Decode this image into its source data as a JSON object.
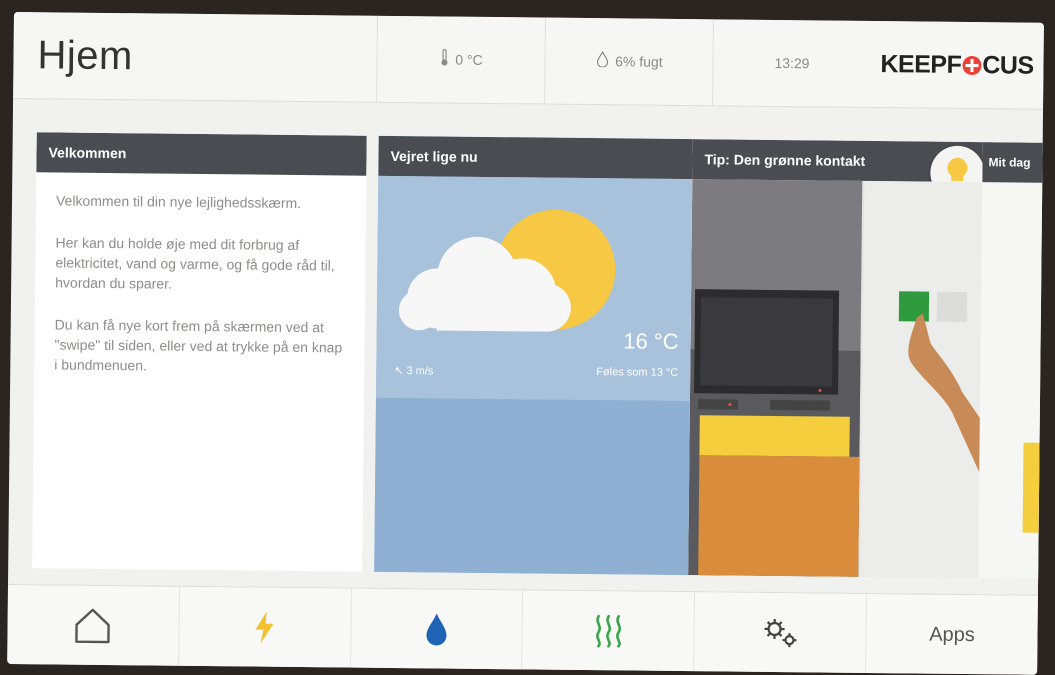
{
  "header": {
    "title": "Hjem",
    "temperature": "0 °C",
    "humidity": "6% fugt",
    "time": "13:29",
    "logo": {
      "left": "KEEPF",
      "right": "CUS"
    }
  },
  "cards": {
    "welcome": {
      "title": "Velkommen",
      "paragraphs": [
        "Velkommen til din nye lejlighedsskærm.",
        "Her kan du holde øje med dit forbrug af elektricitet, vand og varme, og få gode råd til, hvordan du sparer.",
        "Du kan få nye kort frem på skærmen ved at \"swipe\" til siden, eller ved at trykke på en knap i bundmenuen."
      ]
    },
    "weather": {
      "title": "Vejret lige nu",
      "temperature": "16 °C",
      "wind": "3 m/s",
      "feels_like": "Føles som 13 °C"
    },
    "tip": {
      "title": "Tip: Den grønne kontakt"
    },
    "daily": {
      "title": "Mit dag"
    }
  },
  "nav": {
    "items": [
      {
        "name": "home",
        "icon": "home-icon"
      },
      {
        "name": "electricity",
        "icon": "lightning-icon",
        "color": "#f2c12e"
      },
      {
        "name": "water",
        "icon": "water-drop-icon",
        "color": "#1f63b5"
      },
      {
        "name": "heat",
        "icon": "heat-icon",
        "color": "#3aa54a"
      },
      {
        "name": "settings",
        "icon": "gear-icon"
      },
      {
        "name": "apps",
        "label": "Apps"
      }
    ]
  },
  "colors": {
    "card_header": "#4a4c52",
    "weather_sky": "#a9c2dc",
    "sun": "#f6c843",
    "logo_accent": "#e8423a"
  }
}
